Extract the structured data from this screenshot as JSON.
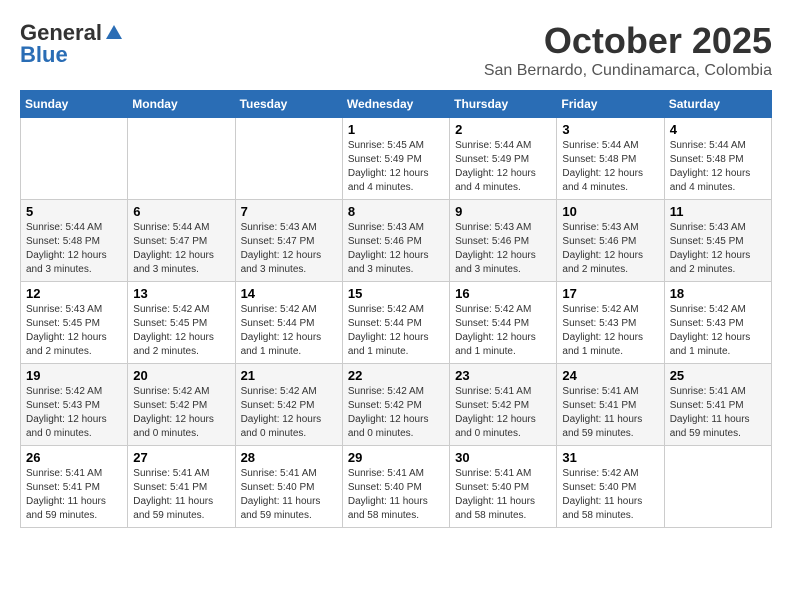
{
  "logo": {
    "general": "General",
    "blue": "Blue"
  },
  "title": "October 2025",
  "subtitle": "San Bernardo, Cundinamarca, Colombia",
  "days_of_week": [
    "Sunday",
    "Monday",
    "Tuesday",
    "Wednesday",
    "Thursday",
    "Friday",
    "Saturday"
  ],
  "weeks": [
    [
      {
        "day": "",
        "info": ""
      },
      {
        "day": "",
        "info": ""
      },
      {
        "day": "",
        "info": ""
      },
      {
        "day": "1",
        "info": "Sunrise: 5:45 AM\nSunset: 5:49 PM\nDaylight: 12 hours\nand 4 minutes."
      },
      {
        "day": "2",
        "info": "Sunrise: 5:44 AM\nSunset: 5:49 PM\nDaylight: 12 hours\nand 4 minutes."
      },
      {
        "day": "3",
        "info": "Sunrise: 5:44 AM\nSunset: 5:48 PM\nDaylight: 12 hours\nand 4 minutes."
      },
      {
        "day": "4",
        "info": "Sunrise: 5:44 AM\nSunset: 5:48 PM\nDaylight: 12 hours\nand 4 minutes."
      }
    ],
    [
      {
        "day": "5",
        "info": "Sunrise: 5:44 AM\nSunset: 5:48 PM\nDaylight: 12 hours\nand 3 minutes."
      },
      {
        "day": "6",
        "info": "Sunrise: 5:44 AM\nSunset: 5:47 PM\nDaylight: 12 hours\nand 3 minutes."
      },
      {
        "day": "7",
        "info": "Sunrise: 5:43 AM\nSunset: 5:47 PM\nDaylight: 12 hours\nand 3 minutes."
      },
      {
        "day": "8",
        "info": "Sunrise: 5:43 AM\nSunset: 5:46 PM\nDaylight: 12 hours\nand 3 minutes."
      },
      {
        "day": "9",
        "info": "Sunrise: 5:43 AM\nSunset: 5:46 PM\nDaylight: 12 hours\nand 3 minutes."
      },
      {
        "day": "10",
        "info": "Sunrise: 5:43 AM\nSunset: 5:46 PM\nDaylight: 12 hours\nand 2 minutes."
      },
      {
        "day": "11",
        "info": "Sunrise: 5:43 AM\nSunset: 5:45 PM\nDaylight: 12 hours\nand 2 minutes."
      }
    ],
    [
      {
        "day": "12",
        "info": "Sunrise: 5:43 AM\nSunset: 5:45 PM\nDaylight: 12 hours\nand 2 minutes."
      },
      {
        "day": "13",
        "info": "Sunrise: 5:42 AM\nSunset: 5:45 PM\nDaylight: 12 hours\nand 2 minutes."
      },
      {
        "day": "14",
        "info": "Sunrise: 5:42 AM\nSunset: 5:44 PM\nDaylight: 12 hours\nand 1 minute."
      },
      {
        "day": "15",
        "info": "Sunrise: 5:42 AM\nSunset: 5:44 PM\nDaylight: 12 hours\nand 1 minute."
      },
      {
        "day": "16",
        "info": "Sunrise: 5:42 AM\nSunset: 5:44 PM\nDaylight: 12 hours\nand 1 minute."
      },
      {
        "day": "17",
        "info": "Sunrise: 5:42 AM\nSunset: 5:43 PM\nDaylight: 12 hours\nand 1 minute."
      },
      {
        "day": "18",
        "info": "Sunrise: 5:42 AM\nSunset: 5:43 PM\nDaylight: 12 hours\nand 1 minute."
      }
    ],
    [
      {
        "day": "19",
        "info": "Sunrise: 5:42 AM\nSunset: 5:43 PM\nDaylight: 12 hours\nand 0 minutes."
      },
      {
        "day": "20",
        "info": "Sunrise: 5:42 AM\nSunset: 5:42 PM\nDaylight: 12 hours\nand 0 minutes."
      },
      {
        "day": "21",
        "info": "Sunrise: 5:42 AM\nSunset: 5:42 PM\nDaylight: 12 hours\nand 0 minutes."
      },
      {
        "day": "22",
        "info": "Sunrise: 5:42 AM\nSunset: 5:42 PM\nDaylight: 12 hours\nand 0 minutes."
      },
      {
        "day": "23",
        "info": "Sunrise: 5:41 AM\nSunset: 5:42 PM\nDaylight: 12 hours\nand 0 minutes."
      },
      {
        "day": "24",
        "info": "Sunrise: 5:41 AM\nSunset: 5:41 PM\nDaylight: 11 hours\nand 59 minutes."
      },
      {
        "day": "25",
        "info": "Sunrise: 5:41 AM\nSunset: 5:41 PM\nDaylight: 11 hours\nand 59 minutes."
      }
    ],
    [
      {
        "day": "26",
        "info": "Sunrise: 5:41 AM\nSunset: 5:41 PM\nDaylight: 11 hours\nand 59 minutes."
      },
      {
        "day": "27",
        "info": "Sunrise: 5:41 AM\nSunset: 5:41 PM\nDaylight: 11 hours\nand 59 minutes."
      },
      {
        "day": "28",
        "info": "Sunrise: 5:41 AM\nSunset: 5:40 PM\nDaylight: 11 hours\nand 59 minutes."
      },
      {
        "day": "29",
        "info": "Sunrise: 5:41 AM\nSunset: 5:40 PM\nDaylight: 11 hours\nand 58 minutes."
      },
      {
        "day": "30",
        "info": "Sunrise: 5:41 AM\nSunset: 5:40 PM\nDaylight: 11 hours\nand 58 minutes."
      },
      {
        "day": "31",
        "info": "Sunrise: 5:42 AM\nSunset: 5:40 PM\nDaylight: 11 hours\nand 58 minutes."
      },
      {
        "day": "",
        "info": ""
      }
    ]
  ]
}
